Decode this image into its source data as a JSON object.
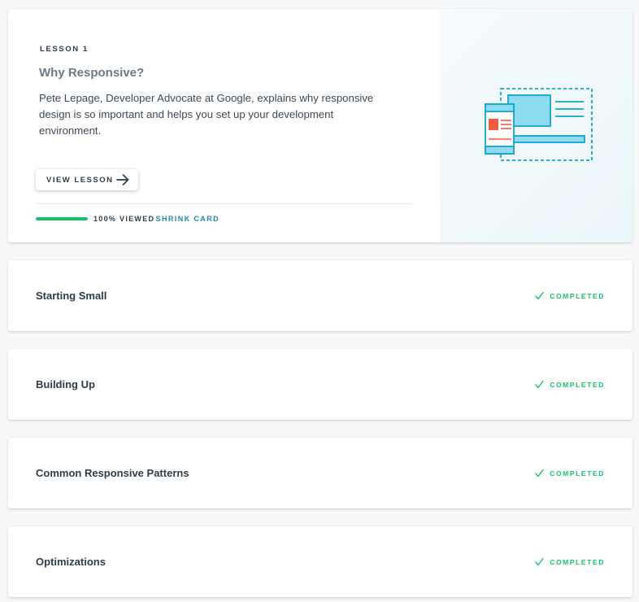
{
  "colors": {
    "accent": "#02b3e4",
    "success": "#15c26b",
    "link": "#1c8aa6",
    "text_dark": "#2e3d49",
    "text_muted": "#6c7a86",
    "illustration_fill": "#8fdbf0",
    "illustration_stroke": "#13a5cc",
    "illustration_red": "#f15b40"
  },
  "expanded_lesson": {
    "label": "LESSON 1",
    "title": "Why Responsive?",
    "description": "Pete Lepage, Developer Advocate at Google, explains why responsive design is so important and helps you set up your development environment.",
    "button_label": "VIEW LESSON",
    "button_icon": "arrow-right-icon",
    "progress_value": 100,
    "progress_text": "100% VIEWED",
    "shrink_label": "SHRINK CARD",
    "illustration": "responsive-devices-illustration"
  },
  "lessons": [
    {
      "title": "Starting Small",
      "status": "COMPLETED",
      "status_icon": "check-icon"
    },
    {
      "title": "Building Up",
      "status": "COMPLETED",
      "status_icon": "check-icon"
    },
    {
      "title": "Common Responsive Patterns",
      "status": "COMPLETED",
      "status_icon": "check-icon"
    },
    {
      "title": "Optimizations",
      "status": "COMPLETED",
      "status_icon": "check-icon"
    }
  ]
}
